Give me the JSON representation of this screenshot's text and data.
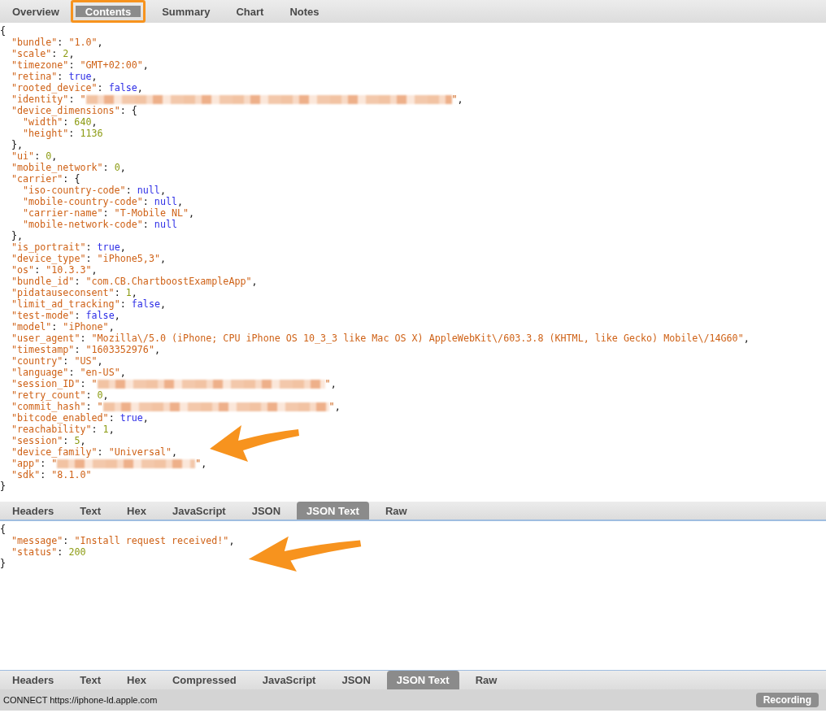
{
  "inspector_tabs": [
    {
      "label": "Overview",
      "selected": false,
      "highlighted": false
    },
    {
      "label": "Contents",
      "selected": true,
      "highlighted": true
    },
    {
      "label": "Summary",
      "selected": false,
      "highlighted": false
    },
    {
      "label": "Chart",
      "selected": false,
      "highlighted": false
    },
    {
      "label": "Notes",
      "selected": false,
      "highlighted": false
    }
  ],
  "request_body": [
    {
      "tokens": [
        {
          "kind": "p",
          "text": "{"
        }
      ],
      "children": [
        {
          "tokens": [
            {
              "kind": "key",
              "text": "\"bundle\""
            },
            {
              "kind": "p",
              "text": ": "
            },
            {
              "kind": "str",
              "text": "\"1.0\""
            },
            {
              "kind": "p",
              "text": ","
            }
          ]
        },
        {
          "tokens": [
            {
              "kind": "key",
              "text": "\"scale\""
            },
            {
              "kind": "p",
              "text": ": "
            },
            {
              "kind": "num",
              "text": "2"
            },
            {
              "kind": "p",
              "text": ","
            }
          ]
        },
        {
          "tokens": [
            {
              "kind": "key",
              "text": "\"timezone\""
            },
            {
              "kind": "p",
              "text": ": "
            },
            {
              "kind": "str",
              "text": "\"GMT+02:00\""
            },
            {
              "kind": "p",
              "text": ","
            }
          ]
        },
        {
          "tokens": [
            {
              "kind": "key",
              "text": "\"retina\""
            },
            {
              "kind": "p",
              "text": ": "
            },
            {
              "kind": "lit",
              "text": "true"
            },
            {
              "kind": "p",
              "text": ","
            }
          ]
        },
        {
          "tokens": [
            {
              "kind": "key",
              "text": "\"rooted_device\""
            },
            {
              "kind": "p",
              "text": ": "
            },
            {
              "kind": "lit",
              "text": "false"
            },
            {
              "kind": "p",
              "text": ","
            }
          ]
        },
        {
          "tokens": [
            {
              "kind": "key",
              "text": "\"identity\""
            },
            {
              "kind": "p",
              "text": ": "
            },
            {
              "kind": "str",
              "text": "\""
            },
            {
              "kind": "blur"
            },
            {
              "kind": "str",
              "text": "\""
            },
            {
              "kind": "p",
              "text": ","
            }
          ]
        },
        {
          "tokens": [
            {
              "kind": "key",
              "text": "\"device_dimensions\""
            },
            {
              "kind": "p",
              "text": ": {"
            }
          ],
          "children": [
            {
              "tokens": [
                {
                  "kind": "key",
                  "text": "\"width\""
                },
                {
                  "kind": "p",
                  "text": ": "
                },
                {
                  "kind": "num",
                  "text": "640"
                },
                {
                  "kind": "p",
                  "text": ","
                }
              ]
            },
            {
              "tokens": [
                {
                  "kind": "key",
                  "text": "\"height\""
                },
                {
                  "kind": "p",
                  "text": ": "
                },
                {
                  "kind": "num",
                  "text": "1136"
                }
              ]
            }
          ]
        },
        {
          "tokens": [
            {
              "kind": "p",
              "text": "},"
            }
          ]
        },
        {
          "tokens": [
            {
              "kind": "key",
              "text": "\"ui\""
            },
            {
              "kind": "p",
              "text": ": "
            },
            {
              "kind": "num",
              "text": "0"
            },
            {
              "kind": "p",
              "text": ","
            }
          ]
        },
        {
          "tokens": [
            {
              "kind": "key",
              "text": "\"mobile_network\""
            },
            {
              "kind": "p",
              "text": ": "
            },
            {
              "kind": "num",
              "text": "0"
            },
            {
              "kind": "p",
              "text": ","
            }
          ]
        },
        {
          "tokens": [
            {
              "kind": "key",
              "text": "\"carrier\""
            },
            {
              "kind": "p",
              "text": ": {"
            }
          ],
          "children": [
            {
              "tokens": [
                {
                  "kind": "key",
                  "text": "\"iso-country-code\""
                },
                {
                  "kind": "p",
                  "text": ": "
                },
                {
                  "kind": "lit",
                  "text": "null"
                },
                {
                  "kind": "p",
                  "text": ","
                }
              ]
            },
            {
              "tokens": [
                {
                  "kind": "key",
                  "text": "\"mobile-country-code\""
                },
                {
                  "kind": "p",
                  "text": ": "
                },
                {
                  "kind": "lit",
                  "text": "null"
                },
                {
                  "kind": "p",
                  "text": ","
                }
              ]
            },
            {
              "tokens": [
                {
                  "kind": "key",
                  "text": "\"carrier-name\""
                },
                {
                  "kind": "p",
                  "text": ": "
                },
                {
                  "kind": "str",
                  "text": "\"T-Mobile NL\""
                },
                {
                  "kind": "p",
                  "text": ","
                }
              ]
            },
            {
              "tokens": [
                {
                  "kind": "key",
                  "text": "\"mobile-network-code\""
                },
                {
                  "kind": "p",
                  "text": ": "
                },
                {
                  "kind": "lit",
                  "text": "null"
                }
              ]
            }
          ]
        },
        {
          "tokens": [
            {
              "kind": "p",
              "text": "},"
            }
          ]
        },
        {
          "tokens": [
            {
              "kind": "key",
              "text": "\"is_portrait\""
            },
            {
              "kind": "p",
              "text": ": "
            },
            {
              "kind": "lit",
              "text": "true"
            },
            {
              "kind": "p",
              "text": ","
            }
          ]
        },
        {
          "tokens": [
            {
              "kind": "key",
              "text": "\"device_type\""
            },
            {
              "kind": "p",
              "text": ": "
            },
            {
              "kind": "str",
              "text": "\"iPhone5,3\""
            },
            {
              "kind": "p",
              "text": ","
            }
          ]
        },
        {
          "tokens": [
            {
              "kind": "key",
              "text": "\"os\""
            },
            {
              "kind": "p",
              "text": ": "
            },
            {
              "kind": "str",
              "text": "\"10.3.3\""
            },
            {
              "kind": "p",
              "text": ","
            }
          ]
        },
        {
          "tokens": [
            {
              "kind": "key",
              "text": "\"bundle_id\""
            },
            {
              "kind": "p",
              "text": ": "
            },
            {
              "kind": "str",
              "text": "\"com.CB.ChartboostExampleApp\""
            },
            {
              "kind": "p",
              "text": ","
            }
          ]
        },
        {
          "tokens": [
            {
              "kind": "key",
              "text": "\"pidatauseconsent\""
            },
            {
              "kind": "p",
              "text": ": "
            },
            {
              "kind": "num",
              "text": "1"
            },
            {
              "kind": "p",
              "text": ","
            }
          ]
        },
        {
          "tokens": [
            {
              "kind": "key",
              "text": "\"limit_ad_tracking\""
            },
            {
              "kind": "p",
              "text": ": "
            },
            {
              "kind": "lit",
              "text": "false"
            },
            {
              "kind": "p",
              "text": ","
            }
          ]
        },
        {
          "tokens": [
            {
              "kind": "key",
              "text": "\"test-mode\""
            },
            {
              "kind": "p",
              "text": ": "
            },
            {
              "kind": "lit",
              "text": "false"
            },
            {
              "kind": "p",
              "text": ","
            }
          ]
        },
        {
          "tokens": [
            {
              "kind": "key",
              "text": "\"model\""
            },
            {
              "kind": "p",
              "text": ": "
            },
            {
              "kind": "str",
              "text": "\"iPhone\""
            },
            {
              "kind": "p",
              "text": ","
            }
          ]
        },
        {
          "tokens": [
            {
              "kind": "key",
              "text": "\"user_agent\""
            },
            {
              "kind": "p",
              "text": ": "
            },
            {
              "kind": "str",
              "text": "\"Mozilla\\/5.0 (iPhone; CPU iPhone OS 10_3_3 like Mac OS X) AppleWebKit\\/603.3.8 (KHTML, like Gecko) Mobile\\/14G60\""
            },
            {
              "kind": "p",
              "text": ","
            }
          ]
        },
        {
          "tokens": [
            {
              "kind": "key",
              "text": "\"timestamp\""
            },
            {
              "kind": "p",
              "text": ": "
            },
            {
              "kind": "str",
              "text": "\"1603352976\""
            },
            {
              "kind": "p",
              "text": ","
            }
          ]
        },
        {
          "tokens": [
            {
              "kind": "key",
              "text": "\"country\""
            },
            {
              "kind": "p",
              "text": ": "
            },
            {
              "kind": "str",
              "text": "\"US\""
            },
            {
              "kind": "p",
              "text": ","
            }
          ]
        },
        {
          "tokens": [
            {
              "kind": "key",
              "text": "\"language\""
            },
            {
              "kind": "p",
              "text": ": "
            },
            {
              "kind": "str",
              "text": "\"en-US\""
            },
            {
              "kind": "p",
              "text": ","
            }
          ]
        },
        {
          "tokens": [
            {
              "kind": "key",
              "text": "\"session_ID\""
            },
            {
              "kind": "p",
              "text": ": "
            },
            {
              "kind": "str",
              "text": "\""
            },
            {
              "kind": "blur"
            },
            {
              "kind": "str",
              "text": "\""
            },
            {
              "kind": "p",
              "text": ","
            }
          ]
        },
        {
          "tokens": [
            {
              "kind": "key",
              "text": "\"retry_count\""
            },
            {
              "kind": "p",
              "text": ": "
            },
            {
              "kind": "num",
              "text": "0"
            },
            {
              "kind": "p",
              "text": ","
            }
          ]
        },
        {
          "tokens": [
            {
              "kind": "key",
              "text": "\"commit_hash\""
            },
            {
              "kind": "p",
              "text": ": "
            },
            {
              "kind": "str",
              "text": "\""
            },
            {
              "kind": "blur"
            },
            {
              "kind": "str",
              "text": "\""
            },
            {
              "kind": "p",
              "text": ","
            }
          ]
        },
        {
          "tokens": [
            {
              "kind": "key",
              "text": "\"bitcode_enabled\""
            },
            {
              "kind": "p",
              "text": ": "
            },
            {
              "kind": "lit",
              "text": "true"
            },
            {
              "kind": "p",
              "text": ","
            }
          ]
        },
        {
          "tokens": [
            {
              "kind": "key",
              "text": "\"reachability\""
            },
            {
              "kind": "p",
              "text": ": "
            },
            {
              "kind": "num",
              "text": "1"
            },
            {
              "kind": "p",
              "text": ","
            }
          ]
        },
        {
          "tokens": [
            {
              "kind": "key",
              "text": "\"session\""
            },
            {
              "kind": "p",
              "text": ": "
            },
            {
              "kind": "num",
              "text": "5"
            },
            {
              "kind": "p",
              "text": ","
            }
          ]
        },
        {
          "tokens": [
            {
              "kind": "key",
              "text": "\"device_family\""
            },
            {
              "kind": "p",
              "text": ": "
            },
            {
              "kind": "str",
              "text": "\"Universal\""
            },
            {
              "kind": "p",
              "text": ","
            }
          ]
        },
        {
          "tokens": [
            {
              "kind": "key",
              "text": "\"app\""
            },
            {
              "kind": "p",
              "text": ": "
            },
            {
              "kind": "str",
              "text": "\""
            },
            {
              "kind": "blur"
            },
            {
              "kind": "str",
              "text": "\""
            },
            {
              "kind": "p",
              "text": ","
            }
          ]
        },
        {
          "tokens": [
            {
              "kind": "key",
              "text": "\"sdk\""
            },
            {
              "kind": "p",
              "text": ": "
            },
            {
              "kind": "str",
              "text": "\"8.1.0\""
            }
          ]
        }
      ]
    },
    {
      "tokens": [
        {
          "kind": "p",
          "text": "}"
        }
      ]
    }
  ],
  "request_tabs": [
    {
      "label": "Headers",
      "selected": false
    },
    {
      "label": "Text",
      "selected": false
    },
    {
      "label": "Hex",
      "selected": false
    },
    {
      "label": "JavaScript",
      "selected": false
    },
    {
      "label": "JSON",
      "selected": false
    },
    {
      "label": "JSON Text",
      "selected": true
    },
    {
      "label": "Raw",
      "selected": false
    }
  ],
  "response_body": [
    {
      "tokens": [
        {
          "kind": "p",
          "text": "{"
        }
      ],
      "children": [
        {
          "tokens": [
            {
              "kind": "key",
              "text": "\"message\""
            },
            {
              "kind": "p",
              "text": ": "
            },
            {
              "kind": "str",
              "text": "\"Install request received!\""
            },
            {
              "kind": "p",
              "text": ","
            }
          ]
        },
        {
          "tokens": [
            {
              "kind": "key",
              "text": "\"status\""
            },
            {
              "kind": "p",
              "text": ": "
            },
            {
              "kind": "num",
              "text": "200"
            }
          ]
        }
      ]
    },
    {
      "tokens": [
        {
          "kind": "p",
          "text": "}"
        }
      ]
    }
  ],
  "response_tabs": [
    {
      "label": "Headers",
      "selected": false
    },
    {
      "label": "Text",
      "selected": false
    },
    {
      "label": "Hex",
      "selected": false
    },
    {
      "label": "Compressed",
      "selected": false
    },
    {
      "label": "JavaScript",
      "selected": false
    },
    {
      "label": "JSON",
      "selected": false
    },
    {
      "label": "JSON Text",
      "selected": true
    },
    {
      "label": "Raw",
      "selected": false
    }
  ],
  "status_bar": {
    "text": "CONNECT https://iphone-ld.apple.com",
    "button": "Recording"
  }
}
